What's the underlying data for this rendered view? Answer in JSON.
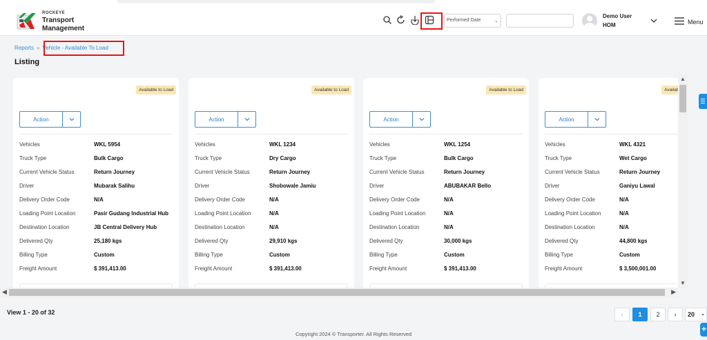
{
  "brand": {
    "company": "ROCKEYE",
    "line1": "Transport",
    "line2": "Management"
  },
  "header": {
    "icons": [
      "search-icon",
      "refresh-icon",
      "download-icon",
      "column-settings-icon"
    ],
    "date_filter": {
      "value": "Performed Date"
    },
    "search": {
      "placeholder": ""
    },
    "user": {
      "name": "Demo User",
      "org": "HOM"
    },
    "menu_label": "Menu"
  },
  "breadcrumb": {
    "root": "Reports",
    "separator": "»",
    "current": "Vehicle - Available To Load"
  },
  "page_title": "Listing",
  "card_labels": {
    "action": "Action",
    "vehicles": "Vehicles",
    "truck_type": "Truck Type",
    "current_status": "Current Vehicle Status",
    "driver": "Driver",
    "delivery_order_code": "Delivery Order Code",
    "loading_point": "Loading Point Location",
    "destination": "Destination Location",
    "delivered_qty": "Delivered Qty",
    "billing_type": "Billing Type",
    "freight_amount": "Freight Amount"
  },
  "cards": [
    {
      "badge": "Available to Load",
      "vehicles": "WKL 5954",
      "truck_type": "Bulk Cargo",
      "current_status": "Return Journey",
      "driver": "Mubarak Salihu",
      "delivery_order_code": "N/A",
      "loading_point": "Pasir Gudang Industrial Hub",
      "destination": "JB Central Delivery Hub",
      "delivered_qty": "25,180 kgs",
      "billing_type": "Custom",
      "freight_amount": "$ 391,413.00"
    },
    {
      "badge": "Available to Load",
      "vehicles": "WKL 1234",
      "truck_type": "Dry Cargo",
      "current_status": "Return Journey",
      "driver": "Shobowale Jamiu",
      "delivery_order_code": "N/A",
      "loading_point": "N/A",
      "destination": "N/A",
      "delivered_qty": "29,910 kgs",
      "billing_type": "Custom",
      "freight_amount": "$ 391,413.00"
    },
    {
      "badge": "Available to Load",
      "vehicles": "WKL 1254",
      "truck_type": "Bulk Cargo",
      "current_status": "Return Journey",
      "driver": "ABUBAKAR Bello",
      "delivery_order_code": "N/A",
      "loading_point": "N/A",
      "destination": "N/A",
      "delivered_qty": "30,000 kgs",
      "billing_type": "Custom",
      "freight_amount": "$ 391,413.00"
    },
    {
      "badge": "Available to Load",
      "vehicles": "WKL 4321",
      "truck_type": "Wet Cargo",
      "current_status": "Return Journey",
      "driver": "Ganiyu Lawal",
      "delivery_order_code": "N/A",
      "loading_point": "N/A",
      "destination": "N/A",
      "delivered_qty": "44,800 kgs",
      "billing_type": "Custom",
      "freight_amount": "$ 3,500,001.00"
    }
  ],
  "pagination": {
    "summary": "View 1 - 20 of 32",
    "prev": "‹",
    "pages": [
      "1",
      "2"
    ],
    "active_page": "1",
    "next": "›",
    "page_size": "20"
  },
  "footer": {
    "copyright": "Copyright 2024 © Transporter. All Rights Reserved"
  },
  "colors": {
    "accent": "#1f8de0",
    "badge_bg": "#fbe7b4",
    "highlight": "#ee1111"
  }
}
